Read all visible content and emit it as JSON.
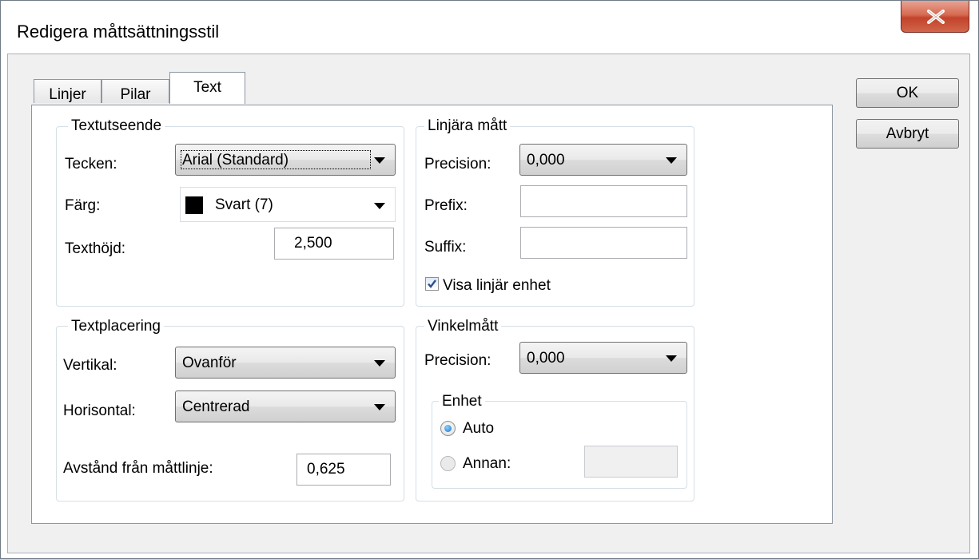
{
  "window": {
    "title": "Redigera måttsättningsstil"
  },
  "tabs": [
    "Linjer",
    "Pilar",
    "Text"
  ],
  "active_tab": "Text",
  "buttons": {
    "ok": "OK",
    "cancel": "Avbryt"
  },
  "text_appearance": {
    "legend": "Textutseende",
    "font_label": "Tecken:",
    "font_value": "Arial (Standard)",
    "color_label": "Färg:",
    "color_value": "Svart (7)",
    "color_swatch": "#000000",
    "height_label": "Texthöjd:",
    "height_value": "2,500"
  },
  "text_placement": {
    "legend": "Textplacering",
    "vertical_label": "Vertikal:",
    "vertical_value": "Ovanför",
    "horizontal_label": "Horisontal:",
    "horizontal_value": "Centrerad",
    "offset_label": "Avstånd från måttlinje:",
    "offset_value": "0,625"
  },
  "linear": {
    "legend": "Linjära mått",
    "precision_label": "Precision:",
    "precision_value": "0,000",
    "prefix_label": "Prefix:",
    "prefix_value": "",
    "suffix_label": "Suffix:",
    "suffix_value": "",
    "show_unit_label": "Visa linjär enhet",
    "show_unit_checked": true
  },
  "angular": {
    "legend": "Vinkelmått",
    "precision_label": "Precision:",
    "precision_value": "0,000",
    "unit_legend": "Enhet",
    "auto_label": "Auto",
    "other_label": "Annan:",
    "other_value": "",
    "selected": "Auto"
  }
}
